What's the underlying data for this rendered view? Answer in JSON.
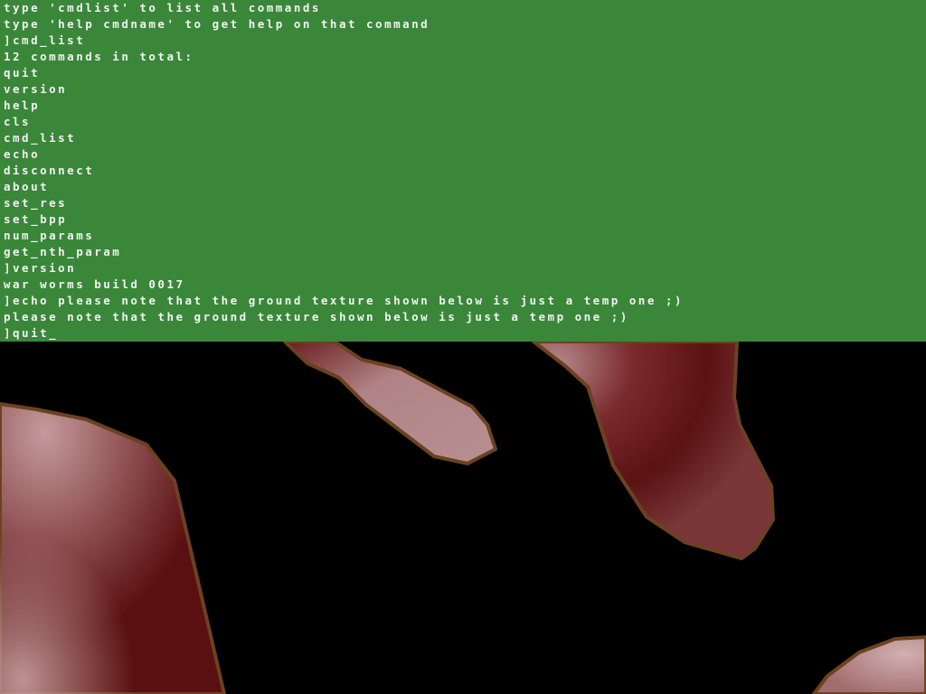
{
  "console": {
    "lines": [
      "type 'cmdlist' to list all commands",
      "type 'help cmdname' to get help on that command",
      "]cmd_list",
      "12 commands in total:",
      "quit",
      "version",
      "help",
      "cls",
      "cmd_list",
      "echo",
      "disconnect",
      "about",
      "set_res",
      "set_bpp",
      "num_params",
      "get_nth_param",
      "]version",
      "war worms build 0017",
      "]echo please note that the ground texture shown below is just a temp one ;)",
      "please note that the ground texture shown below is just a temp one ;)"
    ],
    "prompt": {
      "symbol": "]",
      "input": "quit",
      "cursor": "_"
    },
    "background_color": "#3a873a",
    "text_color": "#f2f2f2"
  },
  "terrain": {
    "fill_dark": "#5a1010",
    "fill_light": "#c49a9c",
    "outline_color": "#6b4220",
    "background_color": "#000000"
  }
}
